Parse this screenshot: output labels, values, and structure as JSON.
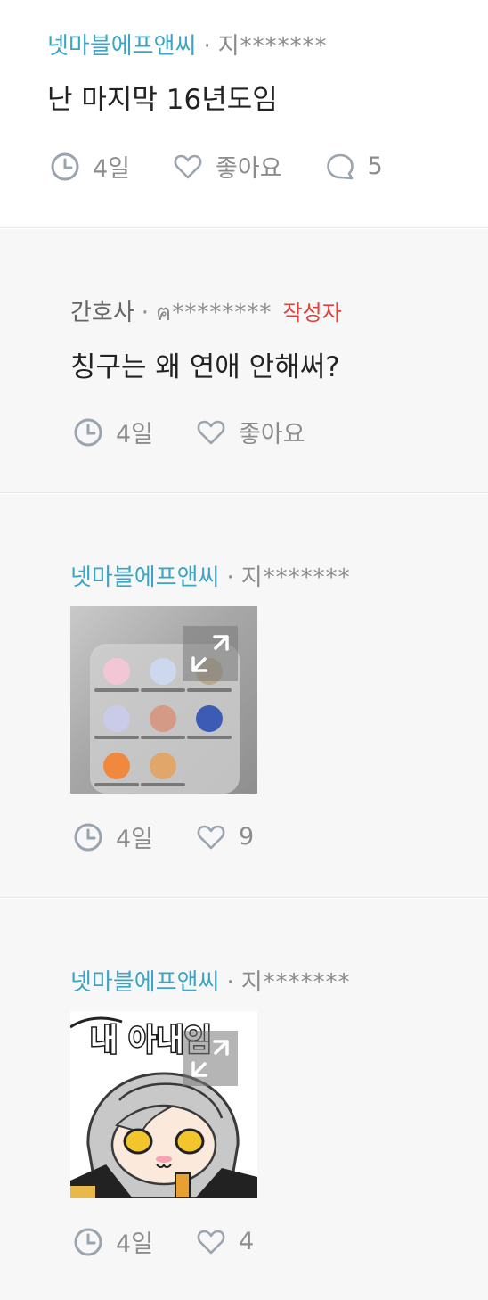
{
  "comments": [
    {
      "author": "넷마블에프앤씨",
      "dot": "·",
      "uid": "지*******",
      "text": "난 마지막 16년도임",
      "time": "4일",
      "likes": "좋아요",
      "replies": "5"
    },
    {
      "author": "간호사",
      "dot": "·",
      "uid": "ฅ********",
      "badge": "작성자",
      "text": "칭구는 왜 연애 안해써?",
      "time": "4일",
      "likes": "좋아요"
    },
    {
      "author": "넷마블에프앤씨",
      "dot": "·",
      "uid": "지*******",
      "time": "4일",
      "likes": "9"
    },
    {
      "author": "넷마블에프앤씨",
      "dot": "·",
      "uid": "지*******",
      "sticker_text": "내 아내임",
      "time": "4일",
      "likes": "4"
    }
  ],
  "icons": {
    "clock": "clock-icon",
    "heart": "heart-icon",
    "reply": "speech-bubble-icon",
    "expand": "expand-icon"
  },
  "colors": {
    "cafe_name": "#3aa6c4",
    "author_badge": "#e2403a",
    "meta_gray": "#8c8c8c"
  }
}
